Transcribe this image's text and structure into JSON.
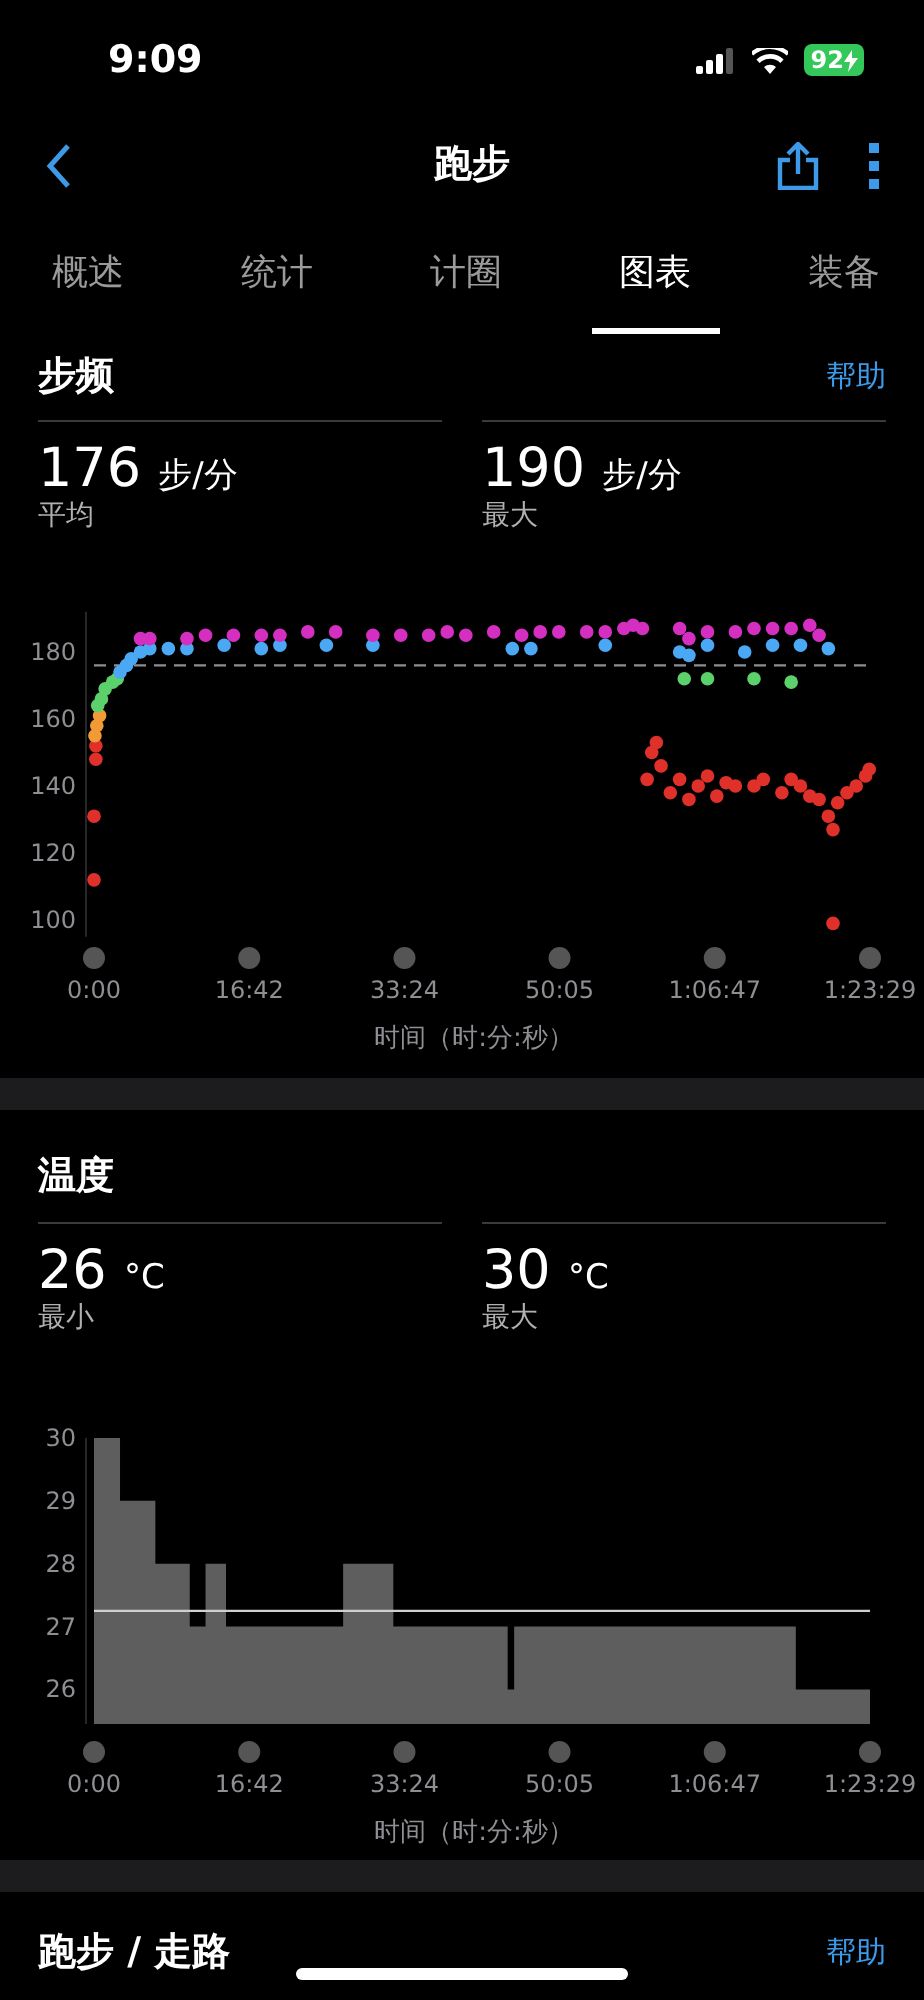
{
  "status_bar": {
    "time": "9:09",
    "battery": "92"
  },
  "nav": {
    "title": "跑步"
  },
  "tabs": [
    {
      "label": "概述",
      "selected": false
    },
    {
      "label": "统计",
      "selected": false
    },
    {
      "label": "计圈",
      "selected": false
    },
    {
      "label": "图表",
      "selected": true
    },
    {
      "label": "装备",
      "selected": false
    }
  ],
  "sections": [
    {
      "title": "步频",
      "help": "帮助",
      "stats": [
        {
          "value": "176",
          "unit": "步/分",
          "label": "平均"
        },
        {
          "value": "190",
          "unit": "步/分",
          "label": "最大"
        }
      ],
      "chart_data": {
        "type": "scatter",
        "xlabel": "时间（时:分:秒）",
        "xlim": [
          0,
          83.48
        ],
        "ylim": [
          95,
          192
        ],
        "yticks": [
          100,
          120,
          140,
          160,
          180
        ],
        "ref_lines": [
          {
            "axis": "y",
            "value": 176
          }
        ],
        "xticks": [
          {
            "value": 0,
            "label": "0:00"
          },
          {
            "value": 16.7,
            "label": "16:42"
          },
          {
            "value": 33.4,
            "label": "33:24"
          },
          {
            "value": 50.08,
            "label": "50:05"
          },
          {
            "value": 66.78,
            "label": "1:06:47"
          },
          {
            "value": 83.48,
            "label": "1:23:29"
          }
        ],
        "series": [
          {
            "color": "#e0302a",
            "x": [
              0,
              0,
              0.2,
              0.2,
              59.5,
              60,
              60.5,
              61,
              62,
              63,
              64,
              65,
              66,
              67,
              68,
              69,
              71,
              72,
              74,
              75,
              76,
              77,
              78,
              79,
              79.5,
              79.5,
              80,
              81,
              82,
              83,
              83.4
            ],
            "values": [
              112,
              131,
              148,
              152,
              142,
              150,
              153,
              146,
              138,
              142,
              136,
              140,
              143,
              137,
              141,
              140,
              140,
              142,
              138,
              142,
              140,
              137,
              136,
              131,
              127,
              99,
              135,
              138,
              140,
              143,
              145
            ]
          },
          {
            "color": "#f29a35",
            "x": [
              0.1,
              0.3,
              0.6
            ],
            "values": [
              155,
              158,
              161
            ]
          },
          {
            "color": "#5cd16b",
            "x": [
              0.4,
              0.8,
              1.2,
              2,
              2.5,
              63.5,
              66,
              71,
              75
            ],
            "values": [
              164,
              166,
              169,
              171,
              172,
              172,
              172,
              172,
              171
            ]
          },
          {
            "color": "#4ba8f5",
            "x": [
              2.8,
              3.5,
              4,
              5,
              6,
              8,
              10,
              14,
              18,
              20,
              25,
              30,
              45,
              47,
              55,
              63,
              64,
              66,
              70,
              73,
              76,
              79
            ],
            "values": [
              174,
              176,
              178,
              180,
              181,
              181,
              181,
              182,
              181,
              182,
              182,
              182,
              181,
              181,
              182,
              180,
              179,
              182,
              180,
              182,
              182,
              181
            ]
          },
          {
            "color": "#d42fc1",
            "x": [
              5,
              6,
              10,
              12,
              15,
              18,
              20,
              23,
              26,
              30,
              33,
              36,
              38,
              40,
              43,
              46,
              48,
              50,
              53,
              55,
              57,
              58,
              59,
              63,
              64,
              66,
              69,
              71,
              73,
              75,
              77,
              78
            ],
            "values": [
              184,
              184,
              184,
              185,
              185,
              185,
              185,
              186,
              186,
              185,
              185,
              185,
              186,
              185,
              186,
              185,
              186,
              186,
              186,
              186,
              187,
              188,
              187,
              187,
              184,
              186,
              186,
              187,
              187,
              187,
              188,
              185
            ]
          }
        ]
      }
    },
    {
      "title": "温度",
      "stats": [
        {
          "value": "26",
          "unit": "°C",
          "label": "最小"
        },
        {
          "value": "30",
          "unit": "°C",
          "label": "最大"
        }
      ],
      "chart_data": {
        "type": "area",
        "xlabel": "时间（时:分:秒）",
        "xlim": [
          0,
          83.48
        ],
        "ylim": [
          25.45,
          30
        ],
        "yticks": [
          26,
          27,
          28,
          29,
          30
        ],
        "ref_lines": [
          {
            "axis": "y",
            "value": 27.25
          }
        ],
        "xticks": [
          {
            "value": 0,
            "label": "0:00"
          },
          {
            "value": 16.7,
            "label": "16:42"
          },
          {
            "value": 33.4,
            "label": "33:24"
          },
          {
            "value": 50.08,
            "label": "50:05"
          },
          {
            "value": 66.78,
            "label": "1:06:47"
          },
          {
            "value": 83.48,
            "label": "1:23:29"
          }
        ],
        "x": [
          0,
          2.8,
          6.6,
          10.3,
          12,
          14.2,
          26.8,
          32.2,
          44.5,
          45.2,
          75.5,
          83.48
        ],
        "series": [
          {
            "color": "#5e5e5e",
            "values": [
              30,
              29,
              28,
              27,
              28,
              27,
              28,
              27,
              26,
              27,
              26,
              26
            ]
          }
        ]
      }
    },
    {
      "title": "跑步 / 走路",
      "help": "帮助"
    }
  ]
}
